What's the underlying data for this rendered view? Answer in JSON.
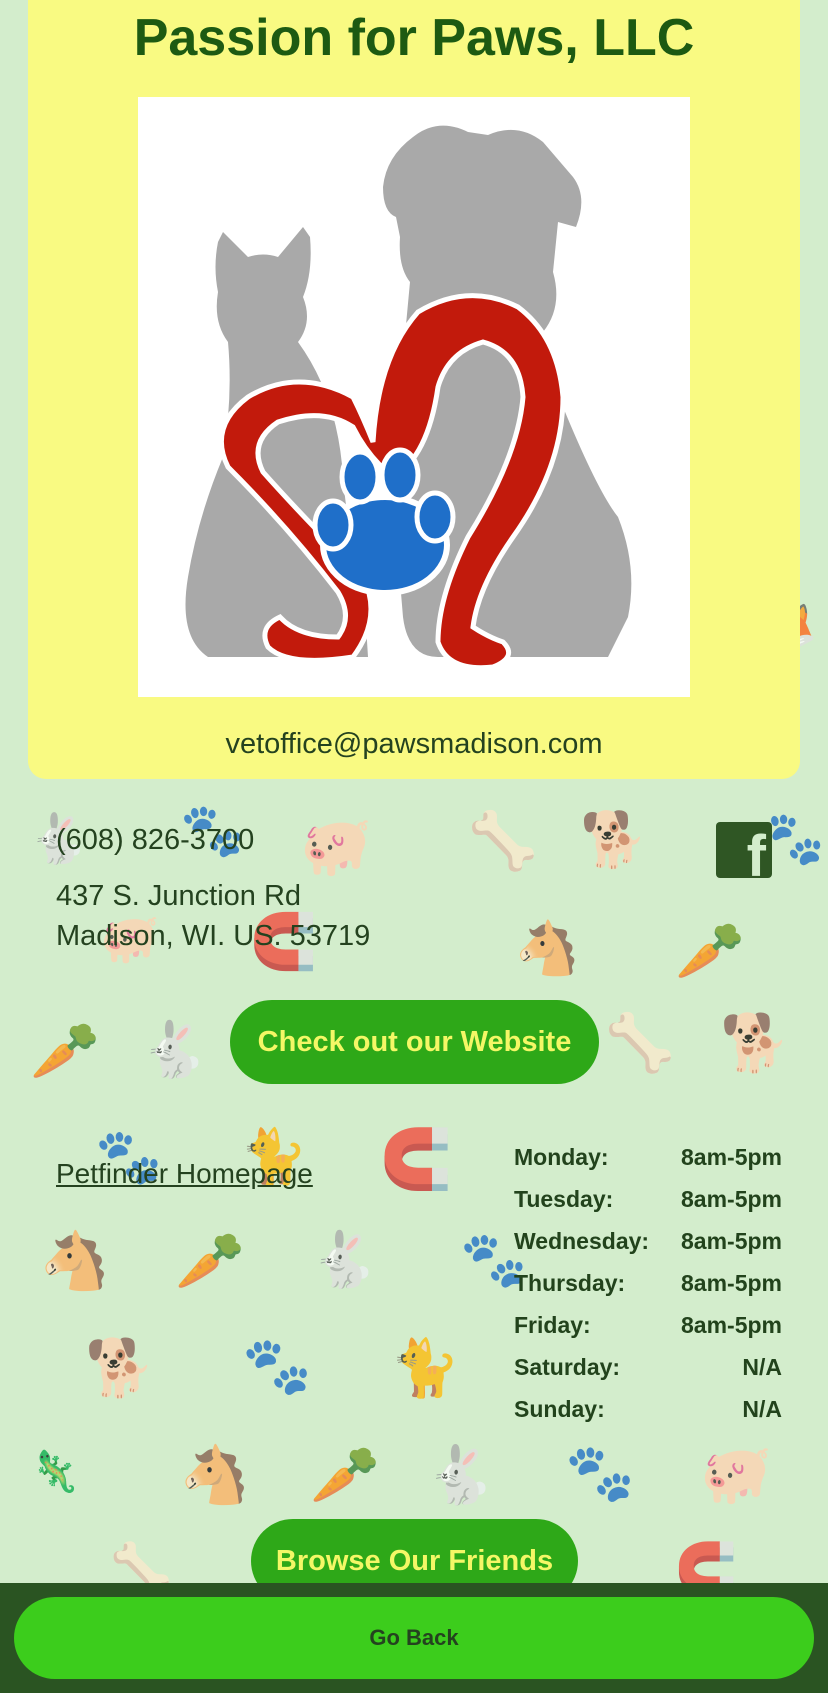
{
  "header": {
    "title": "Passion for Paws, LLC",
    "email": "vetoffice@pawsmadison.com"
  },
  "contact": {
    "phone": "(608) 826-3700",
    "address_line1": "437 S. Junction Rd",
    "address_line2": "Madison, WI. US. 53719",
    "facebook_glyph": "f"
  },
  "buttons": {
    "website": "Check out our Website",
    "browse": "Browse Our Friends",
    "go_back": "Go Back"
  },
  "links": {
    "petfinder": "Petfinder Homepage"
  },
  "hours": [
    {
      "day": "Monday:",
      "time": "8am-5pm"
    },
    {
      "day": "Tuesday:",
      "time": "8am-5pm"
    },
    {
      "day": "Wednesday:",
      "time": "8am-5pm"
    },
    {
      "day": "Thursday:",
      "time": "8am-5pm"
    },
    {
      "day": "Friday:",
      "time": "8am-5pm"
    },
    {
      "day": "Saturday:",
      "time": "N/A"
    },
    {
      "day": "Sunday:",
      "time": "N/A"
    }
  ],
  "icons": {
    "logo": "cat-dog-heart-paw-logo",
    "facebook": "facebook-icon",
    "background": "animal-pattern"
  },
  "colors": {
    "background": "#d3edcc",
    "card": "#f9fa82",
    "title": "#1d5a12",
    "button": "#2ea818",
    "button_text": "#f4f766",
    "footer": "#2a5422",
    "go_back": "#3ccd1c"
  }
}
